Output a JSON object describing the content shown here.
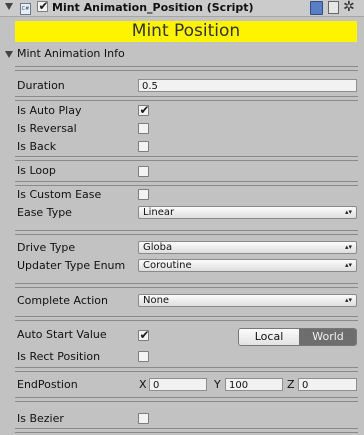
{
  "header": {
    "title": "Mint Animation_Position (Script)",
    "enabled": true,
    "script_icon": "cs-script-icon",
    "script_icon_text": "C#"
  },
  "banner": {
    "text": "Mint Position",
    "color": "#fff400"
  },
  "section": {
    "title": "Mint Animation Info"
  },
  "fields": {
    "duration": {
      "label": "Duration",
      "value": "0.5"
    },
    "is_auto_play": {
      "label": "Is Auto Play",
      "checked": true
    },
    "is_reversal": {
      "label": "Is Reversal",
      "checked": false
    },
    "is_back": {
      "label": "Is Back",
      "checked": false
    },
    "is_loop": {
      "label": "Is Loop",
      "checked": false
    },
    "is_custom_ease": {
      "label": "Is Custom Ease",
      "checked": false
    },
    "ease_type": {
      "label": "Ease Type",
      "value": "Linear"
    },
    "drive_type": {
      "label": "Drive Type",
      "value": "Globa"
    },
    "updater_type": {
      "label": "Updater Type Enum",
      "value": "Coroutine"
    },
    "complete_action": {
      "label": "Complete Action",
      "value": "None"
    },
    "auto_start_value": {
      "label": "Auto Start Value",
      "checked": true
    },
    "space_toggle": {
      "local": "Local",
      "world": "World",
      "selected": "World"
    },
    "is_rect_position": {
      "label": "Is Rect Position",
      "checked": false
    },
    "end_position": {
      "label": "EndPostion",
      "x_label": "X",
      "x": "0",
      "y_label": "Y",
      "y": "100",
      "z_label": "Z",
      "z": "0"
    },
    "is_bezier": {
      "label": "Is Bezier",
      "checked": false
    }
  },
  "glyphs": {
    "check": "✔",
    "dropdown_arrows": "▴▾",
    "gear": "✲"
  }
}
